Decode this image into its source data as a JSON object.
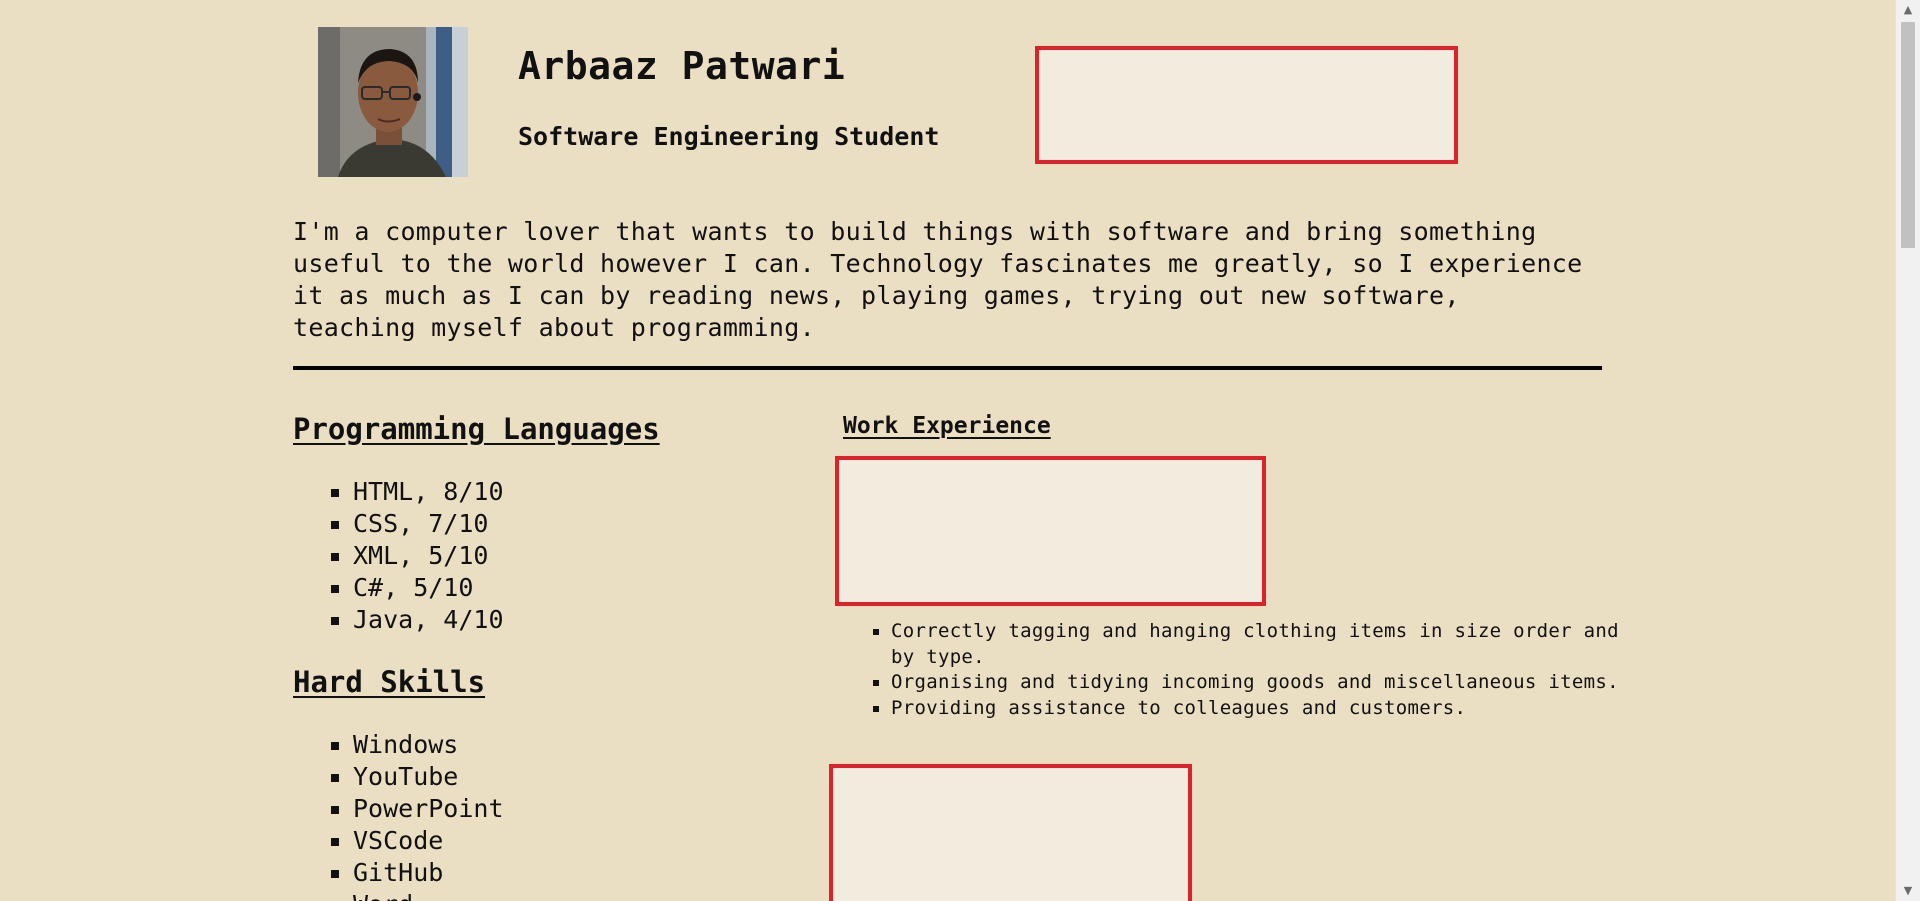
{
  "header": {
    "name": "Arbaaz Patwari",
    "subtitle": "Software Engineering Student",
    "photo_icon": "profile-photo"
  },
  "intro": "I'm a computer lover that wants to build things with software and bring something useful to the world however I can. Technology fascinates me greatly, so I experience it as much as I can by reading news, playing games, trying out new software, teaching myself about programming.",
  "languages": {
    "heading": "Programming Languages",
    "items": [
      "HTML, 8/10",
      "CSS, 7/10",
      "XML, 5/10",
      "C#, 5/10",
      "Java, 4/10"
    ]
  },
  "skills": {
    "heading": "Hard Skills",
    "items": [
      "Windows",
      "YouTube",
      "PowerPoint",
      "VSCode",
      "GitHub",
      "Word"
    ]
  },
  "work": {
    "heading": "Work Experience",
    "items": [
      "Correctly tagging and hanging clothing items in size order and by type.",
      "Organising and tidying incoming goods and miscellaneous items.",
      "Providing assistance to colleagues and customers."
    ]
  },
  "colors": {
    "background": "#ebdfc3",
    "redacted_border": "#dd222b",
    "redacted_fill": "#f1ecdd"
  }
}
